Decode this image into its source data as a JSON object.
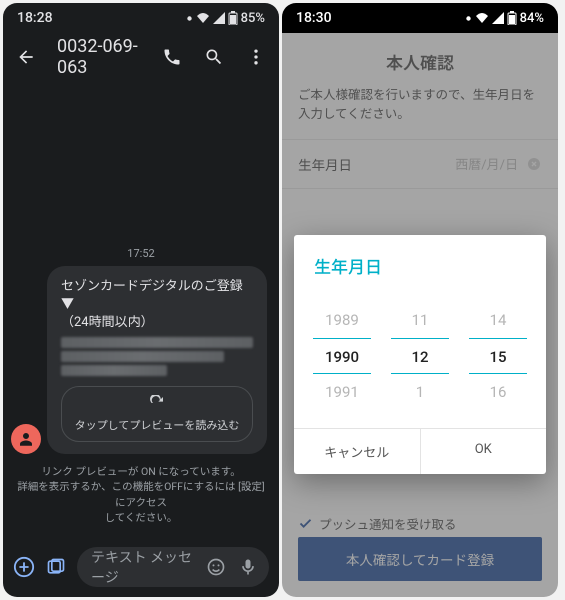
{
  "left": {
    "status": {
      "time": "18:28",
      "battery": "85%"
    },
    "toolbar": {
      "title": "0032-069-063"
    },
    "timestamp": "17:52",
    "msg": {
      "title_line1": "セゾンカードデジタルのご登録▼",
      "title_line2": "（24時間以内）"
    },
    "reload_label": "タップしてプレビューを読み込む",
    "footnote_line1": "リンク プレビューが ON になっています。",
    "footnote_line2": "詳細を表示するか、この機能をOFFにするには [設定] にアクセス",
    "footnote_line3": "してください。",
    "composer": {
      "placeholder": "テキスト メッセージ"
    }
  },
  "right": {
    "status": {
      "time": "18:30",
      "battery": "84%"
    },
    "title": "本人確認",
    "desc": "ご本人様確認を行いますので、生年月日を入力してください。",
    "field": {
      "label": "生年月日",
      "placeholder": "西暦/月/日"
    },
    "checkbox": "プッシュ通知を受け取る",
    "submit": "本人確認してカード登録",
    "dialog": {
      "title": "生年月日",
      "year": {
        "prev": "1989",
        "sel": "1990",
        "next": "1991"
      },
      "month": {
        "prev": "11",
        "sel": "12",
        "next": "1"
      },
      "day": {
        "prev": "14",
        "sel": "15",
        "next": "16"
      },
      "cancel": "キャンセル",
      "ok": "OK"
    }
  }
}
